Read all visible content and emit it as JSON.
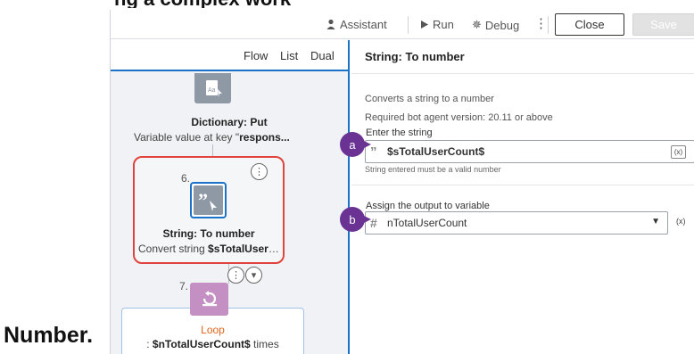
{
  "toolbar": {
    "assistant_label": "Assistant",
    "run_label": "Run",
    "debug_label": "Debug",
    "close_label": "Close",
    "save_label": "Save"
  },
  "flow_tabs": [
    "Flow",
    "List",
    "Dual"
  ],
  "flow": {
    "dict_put": {
      "title": "Dictionary: Put",
      "desc_prefix": "Variable value at key \"",
      "desc_bold": "respons..."
    },
    "string_node": {
      "step": "6.",
      "title": "String: To number",
      "desc_prefix": "Convert string ",
      "desc_bold": "$sTotalUserCo..."
    },
    "loop_node": {
      "step": "7.",
      "title": "Loop",
      "desc_prefix": ": ",
      "desc_bold": "$nTotalUserCount$",
      "desc_suffix": " times"
    }
  },
  "panel": {
    "title": "String: To number",
    "description": "Converts a string to a number",
    "requirement": "Required bot agent version: 20.11 or above",
    "string_field": {
      "label": "Enter the string",
      "value": "$sTotalUserCount$",
      "hint": "String entered must be a valid number",
      "var_button": "(x)"
    },
    "output_field": {
      "label": "Assign the output to variable",
      "value": "nTotalUserCount",
      "var_button": "(x)"
    }
  },
  "callouts": {
    "a": "a",
    "b": "b"
  },
  "doc": {
    "caption_top": "ng a complex workflow, copy the steps (with appropriate",
    "caption_bottom": "Number."
  },
  "colors": {
    "accent_blue": "#1a72c9",
    "highlight_red": "#e0443e",
    "callout_purple": "#6a3393",
    "loop_pink": "#c48fc3",
    "loop_orange": "#e0641c"
  }
}
